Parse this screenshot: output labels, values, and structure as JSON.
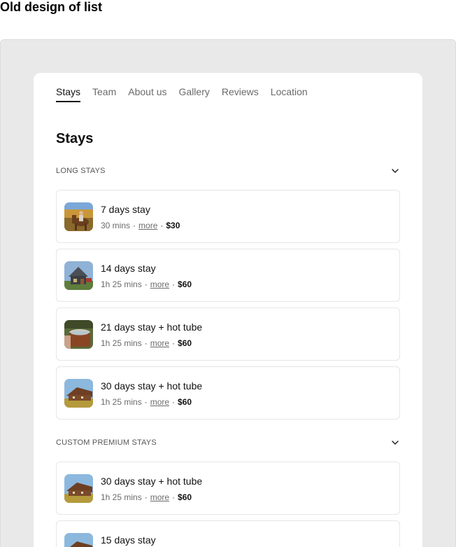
{
  "page": {
    "heading": "Old design of list"
  },
  "tabs": [
    {
      "label": "Stays",
      "active": true
    },
    {
      "label": "Team"
    },
    {
      "label": "About us"
    },
    {
      "label": "Gallery"
    },
    {
      "label": "Reviews"
    },
    {
      "label": "Location"
    }
  ],
  "section": {
    "title": "Stays"
  },
  "groups": [
    {
      "label": "LONG STAYS",
      "items": [
        {
          "title": "7 days stay",
          "duration": "30 mins",
          "more": "more",
          "price": "$30",
          "thumb": "horse-photo"
        },
        {
          "title": "14 days stay",
          "duration": "1h 25 mins",
          "more": "more",
          "price": "$60",
          "thumb": "cabin-photo"
        },
        {
          "title": "21 days stay + hot tube",
          "duration": "1h 25 mins",
          "more": "more",
          "price": "$60",
          "thumb": "hot-tub-photo"
        },
        {
          "title": "30 days stay + hot tube",
          "duration": "1h 25 mins",
          "more": "more",
          "price": "$60",
          "thumb": "farmhouse-photo"
        }
      ]
    },
    {
      "label": "CUSTOM PREMIUM STAYS",
      "items": [
        {
          "title": "30 days stay + hot tube",
          "duration": "1h 25 mins",
          "more": "more",
          "price": "$60",
          "thumb": "farmhouse-photo"
        },
        {
          "title": "15 days stay",
          "thumb": "farmhouse-photo"
        }
      ]
    }
  ],
  "icons": {
    "group_toggle": "chevron-down-icon",
    "separator": "·"
  },
  "colors": {
    "frame_bg": "#e9e9e9",
    "card_bg": "#ffffff",
    "text": "#111111",
    "muted": "#6b6b6b"
  }
}
